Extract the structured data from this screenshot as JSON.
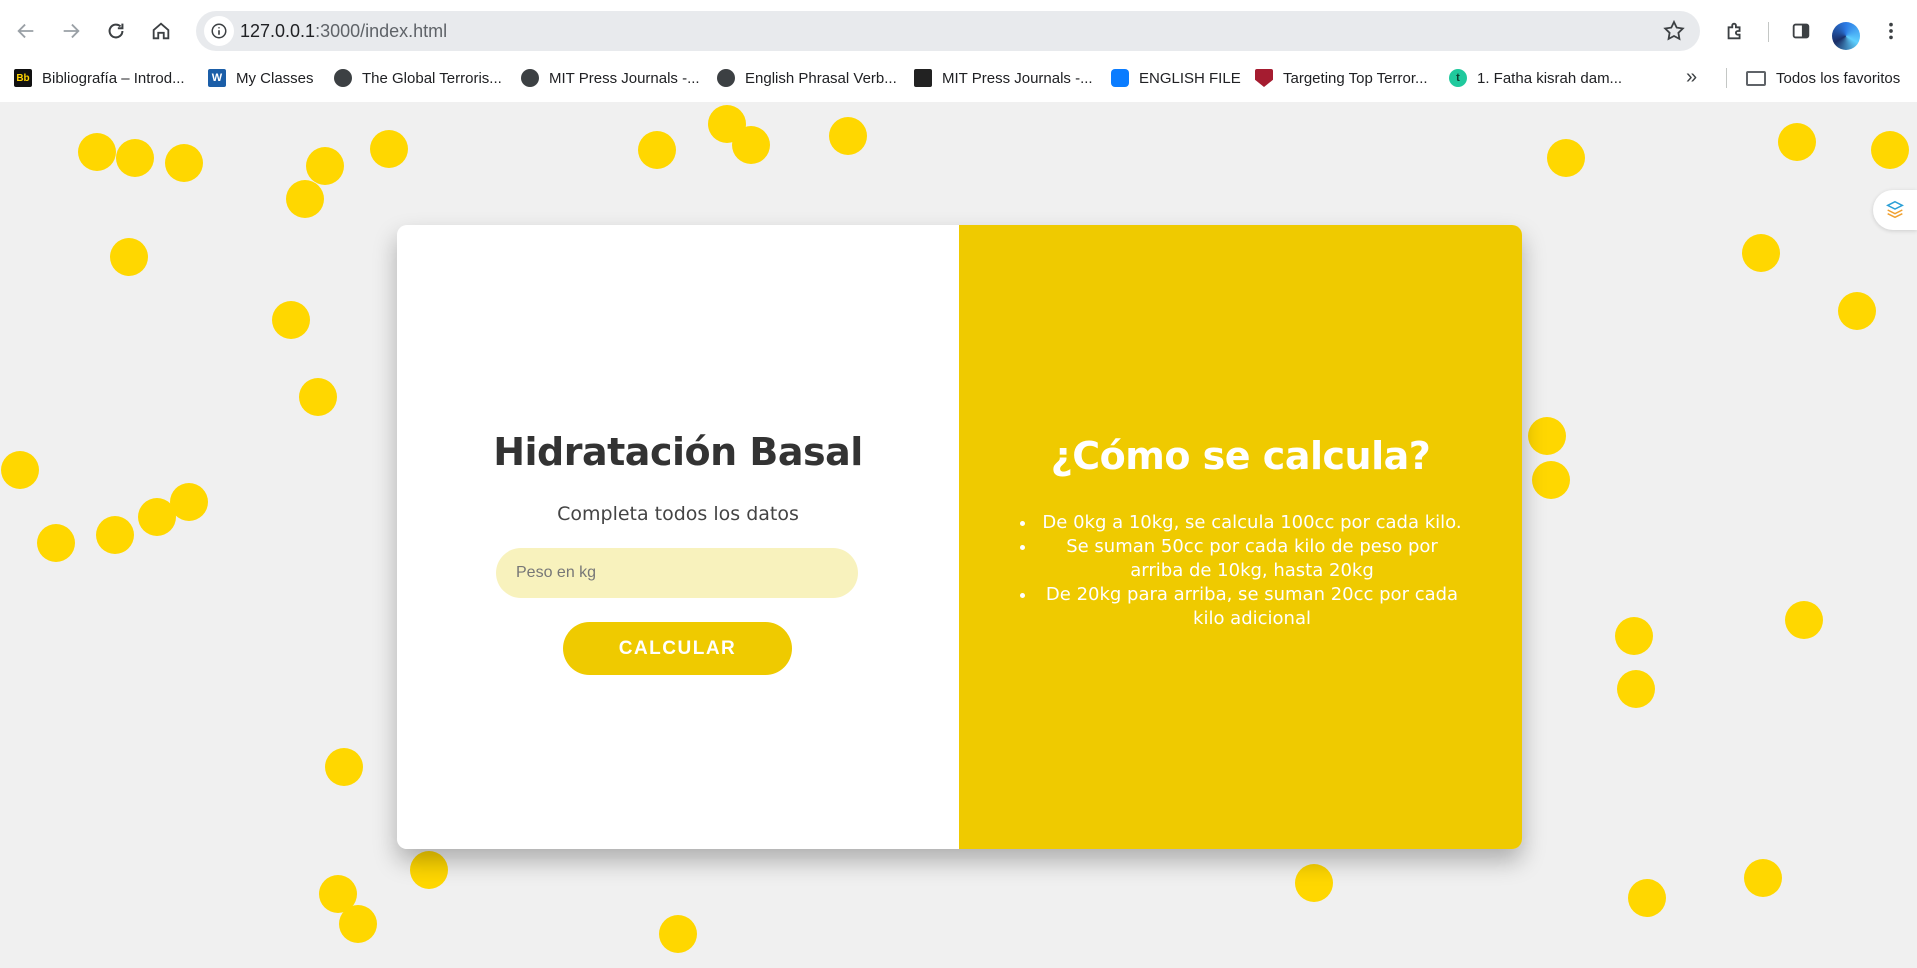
{
  "browser": {
    "url_host": "127.0.0.1",
    "url_rest": ":3000/index.html",
    "bookmarks": [
      {
        "label": "Bibliografía – Introd...",
        "icon": "blackboard-icon"
      },
      {
        "label": "My Classes",
        "icon": "word-icon"
      },
      {
        "label": "The Global Terroris...",
        "icon": "globe-icon"
      },
      {
        "label": "MIT Press Journals -...",
        "icon": "globe-icon"
      },
      {
        "label": "English Phrasal Verb...",
        "icon": "globe-icon"
      },
      {
        "label": "MIT Press Journals -...",
        "icon": "mit-icon"
      },
      {
        "label": "ENGLISH FILE",
        "icon": "vk-icon"
      },
      {
        "label": "Targeting Top Terror...",
        "icon": "harvard-icon"
      },
      {
        "label": "1. Fatha kisrah dam...",
        "icon": "t-icon"
      }
    ],
    "all_bookmarks_label": "Todos los favoritos",
    "bookmark_icon_glyphs": {
      "bb": "Bb",
      "w": "W",
      "t": "t"
    }
  },
  "form": {
    "title": "Hidratación Basal",
    "subtitle": "Completa todos los datos",
    "weight_placeholder": "Peso en kg",
    "calculate_label": "CALCULAR"
  },
  "info": {
    "title": "¿Cómo se calcula?",
    "rules": [
      "De 0kg a 10kg, se calcula 100cc por cada kilo.",
      "Se suman 50cc por cada kilo de peso por arriba de 10kg, hasta 20kg",
      "De 20kg para arriba, se suman 20cc por cada kilo adicional"
    ]
  },
  "colors": {
    "accent": "#efca00",
    "dots": "#ffd700",
    "input_bg": "#f8f2bd",
    "page_bg": "#f0f0f0"
  }
}
